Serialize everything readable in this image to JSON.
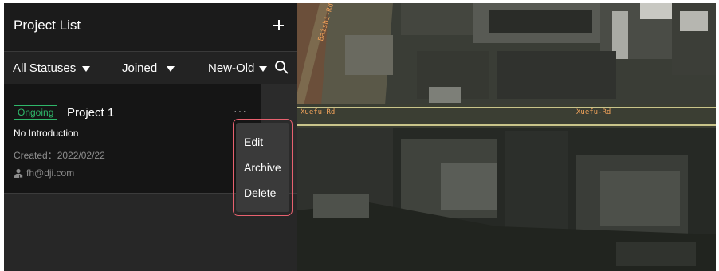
{
  "project_list": {
    "title": "Project List",
    "add_icon": "plus-icon"
  },
  "filters": {
    "status": "All Statuses",
    "membership": "Joined",
    "sort": "New-Old",
    "search_icon": "search-icon"
  },
  "projects": [
    {
      "status": "Ongoing",
      "name": "Project 1",
      "more_label": "···",
      "introduction": "No Introduction",
      "created": "Created：2022/02/22",
      "owner": "fh@dji.com",
      "owner_icon": "user-icon"
    }
  ],
  "context_menu": {
    "items": [
      "Edit",
      "Archive",
      "Delete"
    ]
  },
  "map": {
    "road_labels": [
      "Baishi-Rd",
      "Xuefu-Rd",
      "Xuefu-Rd"
    ]
  },
  "colors": {
    "status_ongoing": "#2fb76a",
    "menu_highlight_border": "#e8616f",
    "road_label": "#f0a25a"
  }
}
